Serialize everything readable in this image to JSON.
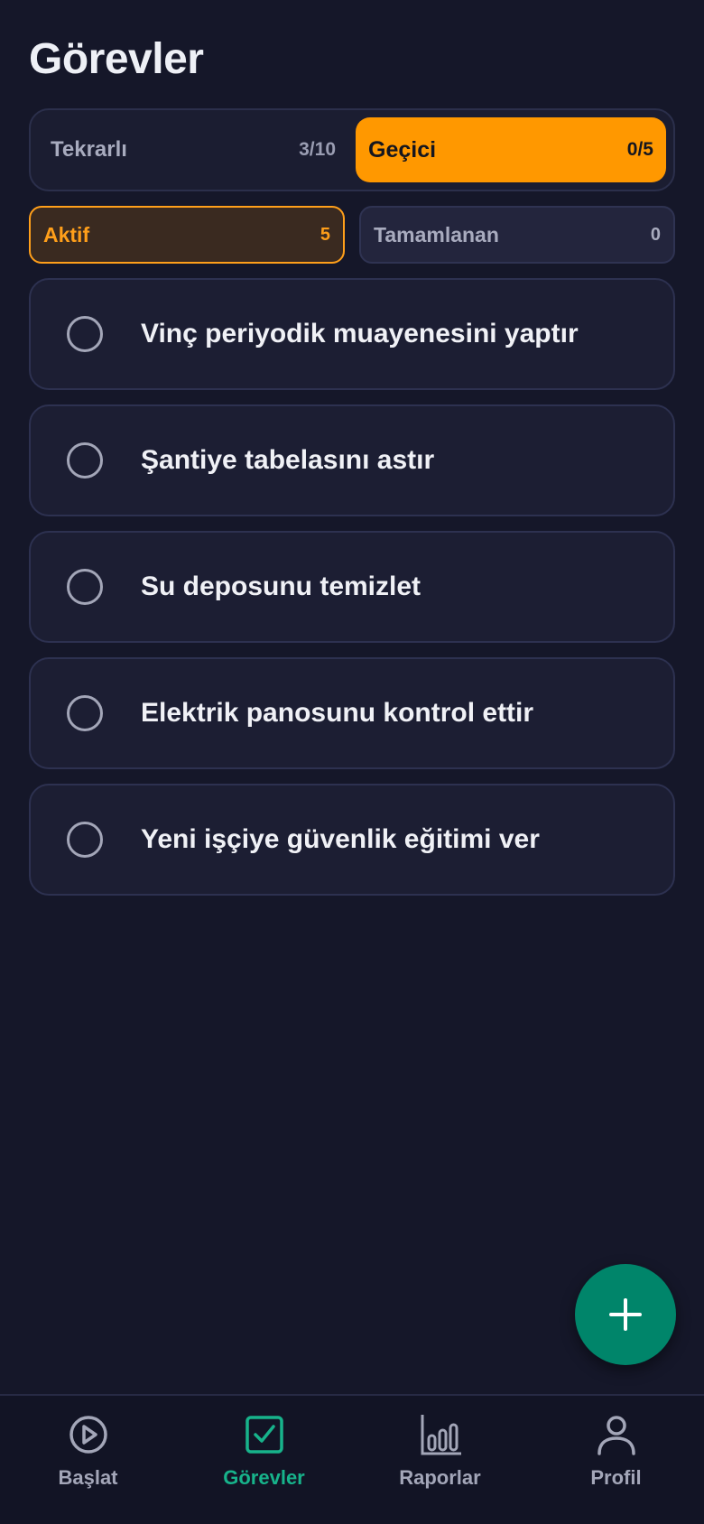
{
  "header": {
    "title": "Görevler"
  },
  "type_switch": [
    {
      "label": "Tekrarlı",
      "count": "3/10",
      "active": false
    },
    {
      "label": "Geçici",
      "count": "0/5",
      "active": true
    }
  ],
  "status_filter": [
    {
      "label": "Aktif",
      "count": "5",
      "active": true
    },
    {
      "label": "Tamamlanan",
      "count": "0",
      "active": false
    }
  ],
  "tasks": [
    {
      "title": "Vinç periyodik muayenesini yaptır",
      "done": false
    },
    {
      "title": "Şantiye tabelasını astır",
      "done": false
    },
    {
      "title": "Su deposunu temizlet",
      "done": false
    },
    {
      "title": "Elektrik panosunu kontrol ettir",
      "done": false
    },
    {
      "title": "Yeni işçiye güvenlik eğitimi ver",
      "done": false
    }
  ],
  "fab": {
    "icon": "plus-icon"
  },
  "bottom_nav": [
    {
      "label": "Başlat",
      "icon": "play-circle-icon",
      "active": false
    },
    {
      "label": "Görevler",
      "icon": "checkbox-icon",
      "active": true
    },
    {
      "label": "Raporlar",
      "icon": "bar-chart-icon",
      "active": false
    },
    {
      "label": "Profil",
      "icon": "user-icon",
      "active": false
    }
  ],
  "colors": {
    "background": "#151729",
    "accent_orange": "#ff9800",
    "accent_green": "#17b38b",
    "fab_green": "#00856a"
  }
}
